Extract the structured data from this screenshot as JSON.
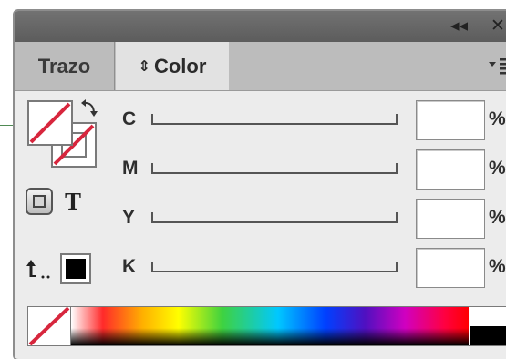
{
  "panel": {
    "tabs": [
      {
        "label": "Trazo",
        "active": false
      },
      {
        "label": "Color",
        "active": true
      }
    ],
    "text_icon_label": "T"
  },
  "channels": [
    {
      "letter": "C",
      "value": "",
      "unit": "%"
    },
    {
      "letter": "M",
      "value": "",
      "unit": "%"
    },
    {
      "letter": "Y",
      "value": "",
      "unit": "%"
    },
    {
      "letter": "K",
      "value": "",
      "unit": "%"
    }
  ],
  "icons": {
    "collapse": "double-chevron-left-icon",
    "close": "close-icon",
    "panel_menu": "panel-menu-icon",
    "swap": "swap-fill-stroke-icon",
    "format_container": "format-container-icon",
    "format_text": "format-text-icon",
    "default_colors": "default-fill-stroke-icon",
    "none_color": "none-color-icon"
  },
  "colors": {
    "none_slash": "#d7263d",
    "callout_line": "#4f8a54",
    "panel_bg": "#ececec",
    "title_bar": "#666666"
  }
}
